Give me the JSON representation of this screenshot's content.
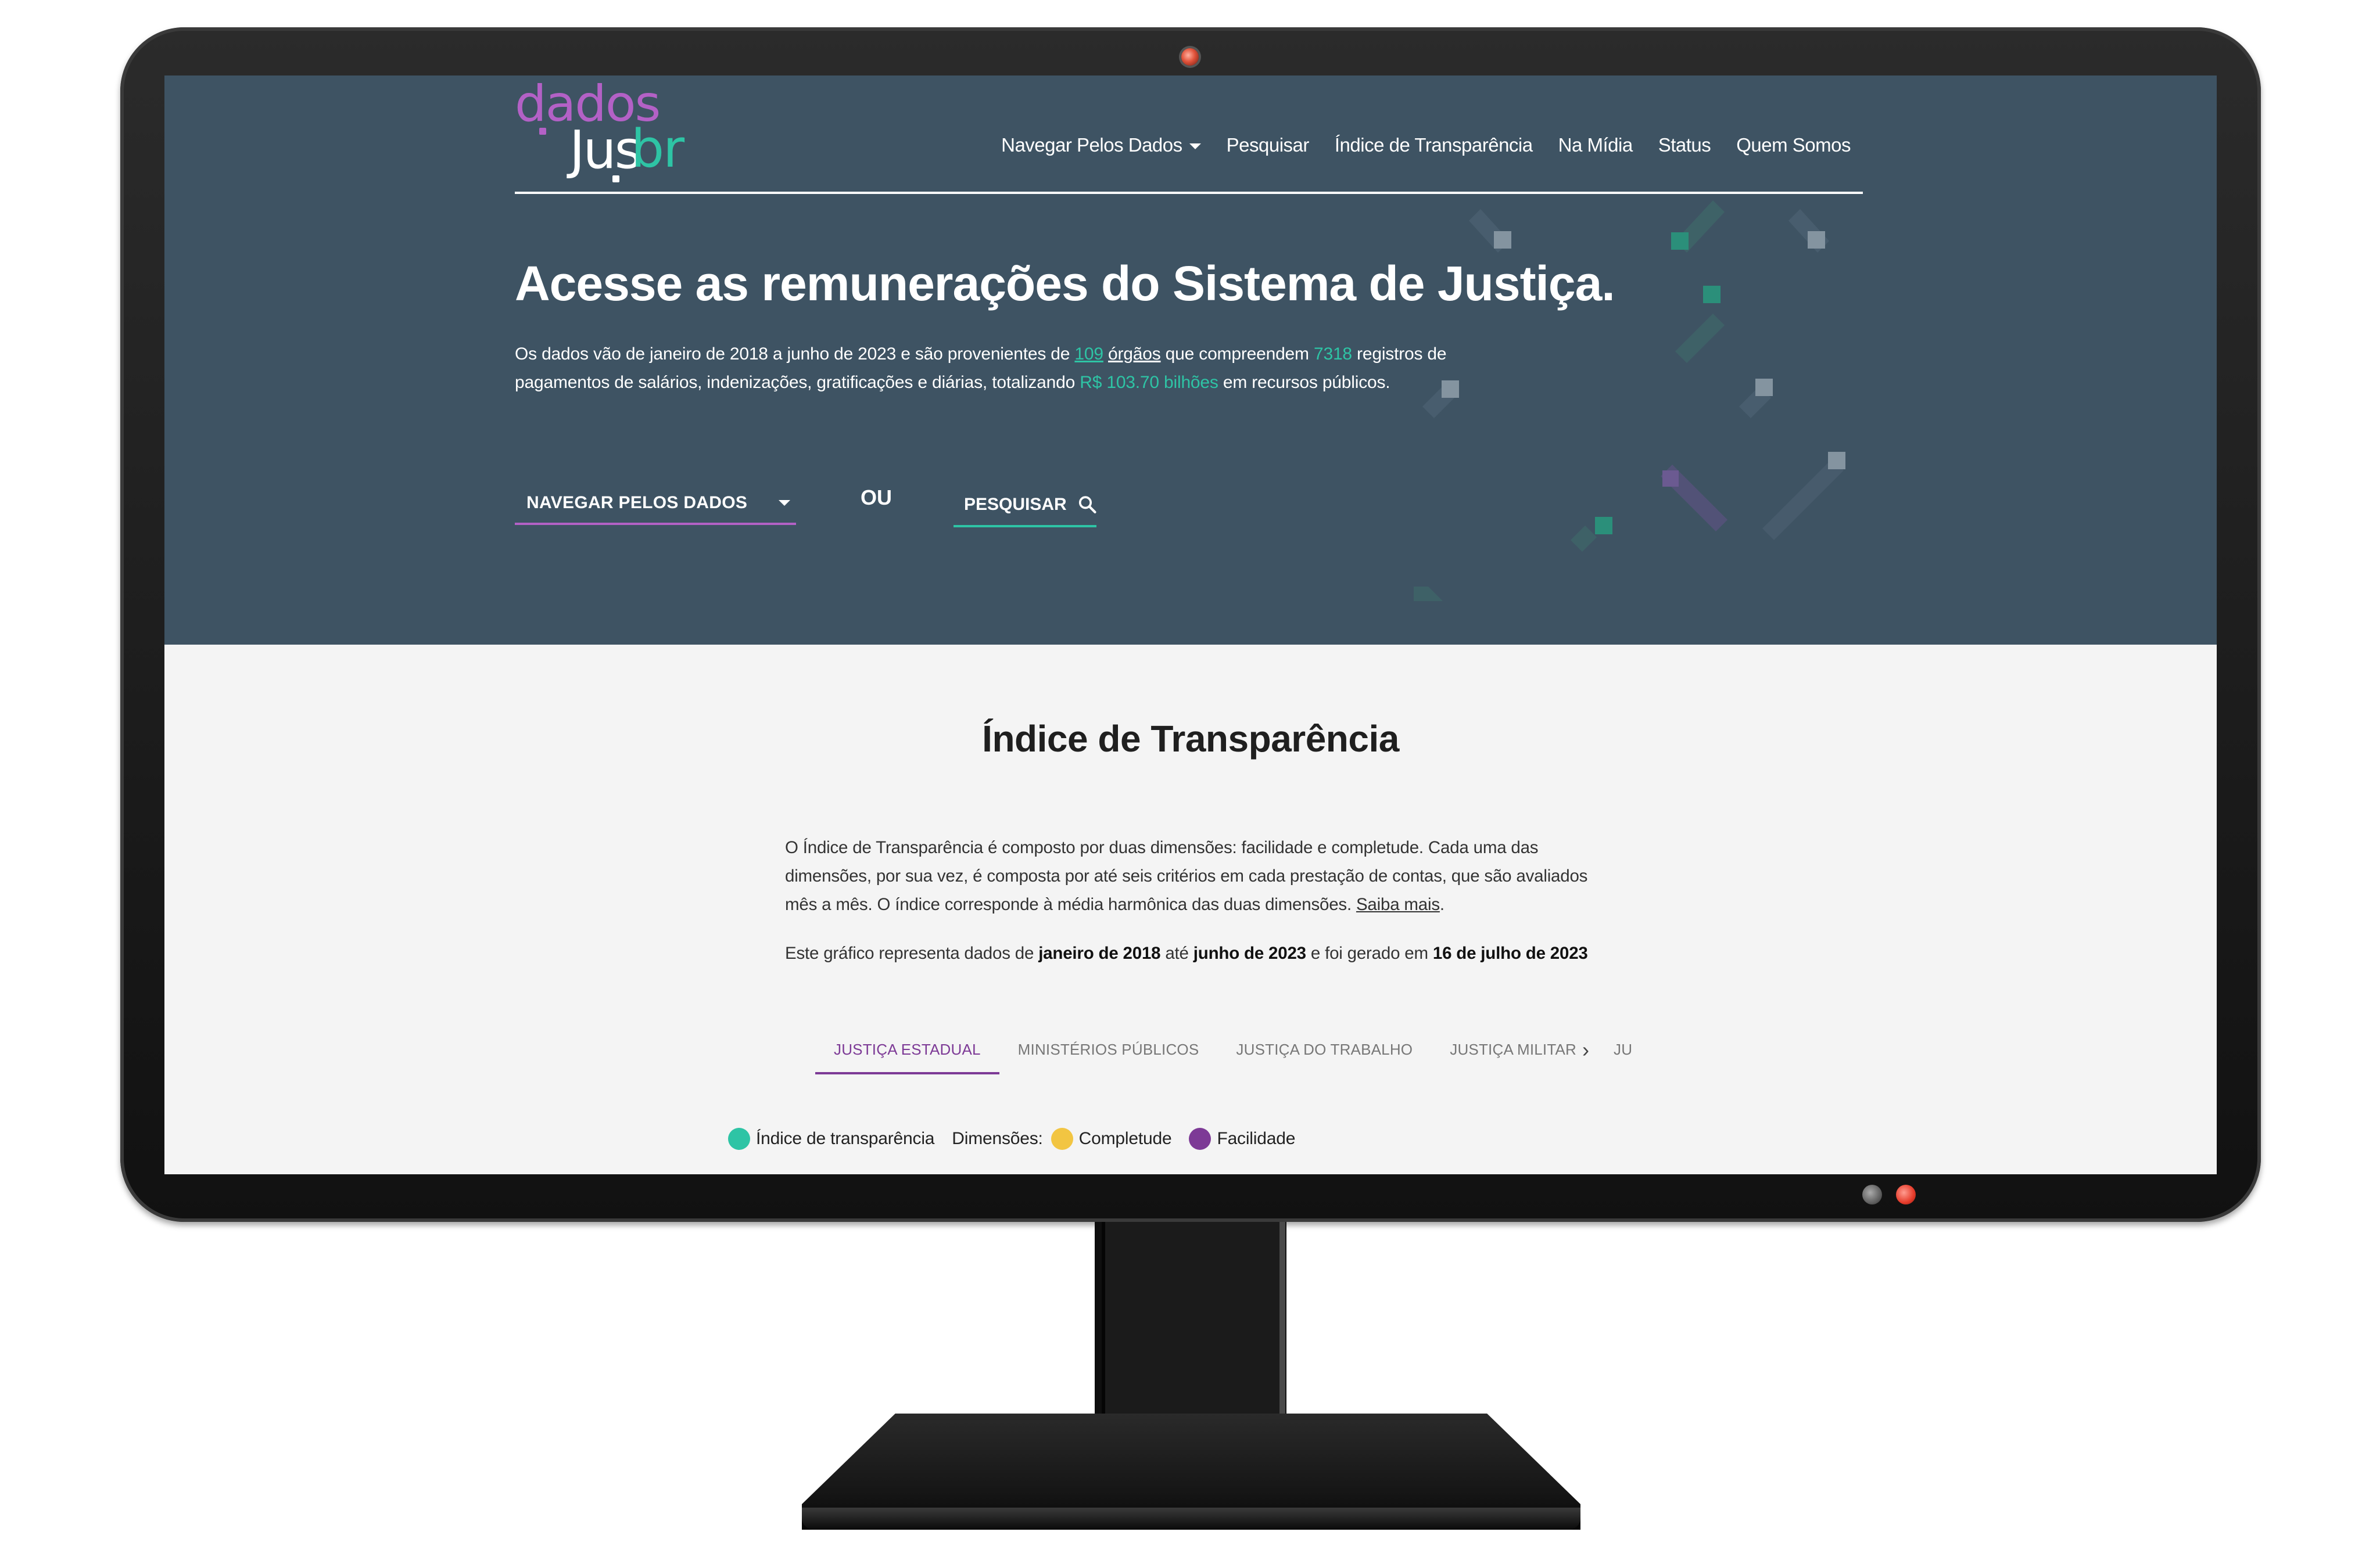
{
  "logo": {
    "part1": "dados",
    "part2": "Jus",
    "part3": "br"
  },
  "nav": {
    "items": [
      {
        "label": "Navegar Pelos Dados"
      },
      {
        "label": "Pesquisar"
      },
      {
        "label": "Índice de Transparência"
      },
      {
        "label": "Na Mídia"
      },
      {
        "label": "Status"
      },
      {
        "label": "Quem Somos"
      }
    ]
  },
  "hero": {
    "title": "Acesse as remunerações do Sistema de Justiça.",
    "text_1": "Os dados vão de janeiro de 2018 a junho de 2023 e são provenientes de ",
    "orgs_count": "109",
    "orgs_word": "órgãos",
    "text_2": " que compreendem ",
    "records_count": "7318",
    "text_3": " registros de pagamentos de salários, indenizações, gratificações e diárias, totalizando ",
    "total_value": "R$ 103.70 bilhões",
    "text_4": " em recursos públicos.",
    "browse_label": "NAVEGAR PELOS DADOS",
    "or_label": "OU",
    "search_label": "PESQUISAR"
  },
  "transparency": {
    "title": "Índice de Transparência",
    "desc": "O Índice de Transparência é composto por duas dimensões: facilidade e completude. Cada uma das dimensões, por sua vez, é composta por até seis critérios em cada prestação de contas, que são avaliados mês a mês. O índice corresponde à média harmônica das duas dimensões. ",
    "learn_more": "Saiba mais",
    "period_prefix": "Este gráfico representa dados de ",
    "period_start": "janeiro de 2018",
    "period_mid": " até ",
    "period_end": "junho de 2023",
    "generated_mid": " e foi gerado em ",
    "generated_date": "16 de julho de 2023",
    "tabs": [
      {
        "label": "JUSTIÇA ESTADUAL"
      },
      {
        "label": "MINISTÉRIOS PÚBLICOS"
      },
      {
        "label": "JUSTIÇA DO TRABALHO"
      },
      {
        "label": "JUSTIÇA MILITAR"
      },
      {
        "label": "JUS"
      }
    ],
    "legend": {
      "index_label": "Índice de transparência",
      "dimensions_label": "Dimensões:",
      "completeness_label": "Completude",
      "ease_label": "Facilidade"
    }
  },
  "colors": {
    "hero_bg": "#3e5363",
    "accent_green": "#2ec4a5",
    "accent_purple": "#b361c6",
    "tab_active": "#7d3a96",
    "legend_index": "#2ec4a5",
    "legend_completeness": "#f2c542",
    "legend_ease": "#7d3a96"
  },
  "icons": {
    "search": "search-icon",
    "dropdown": "chevron-down-icon",
    "next": "chevron-right-icon"
  }
}
